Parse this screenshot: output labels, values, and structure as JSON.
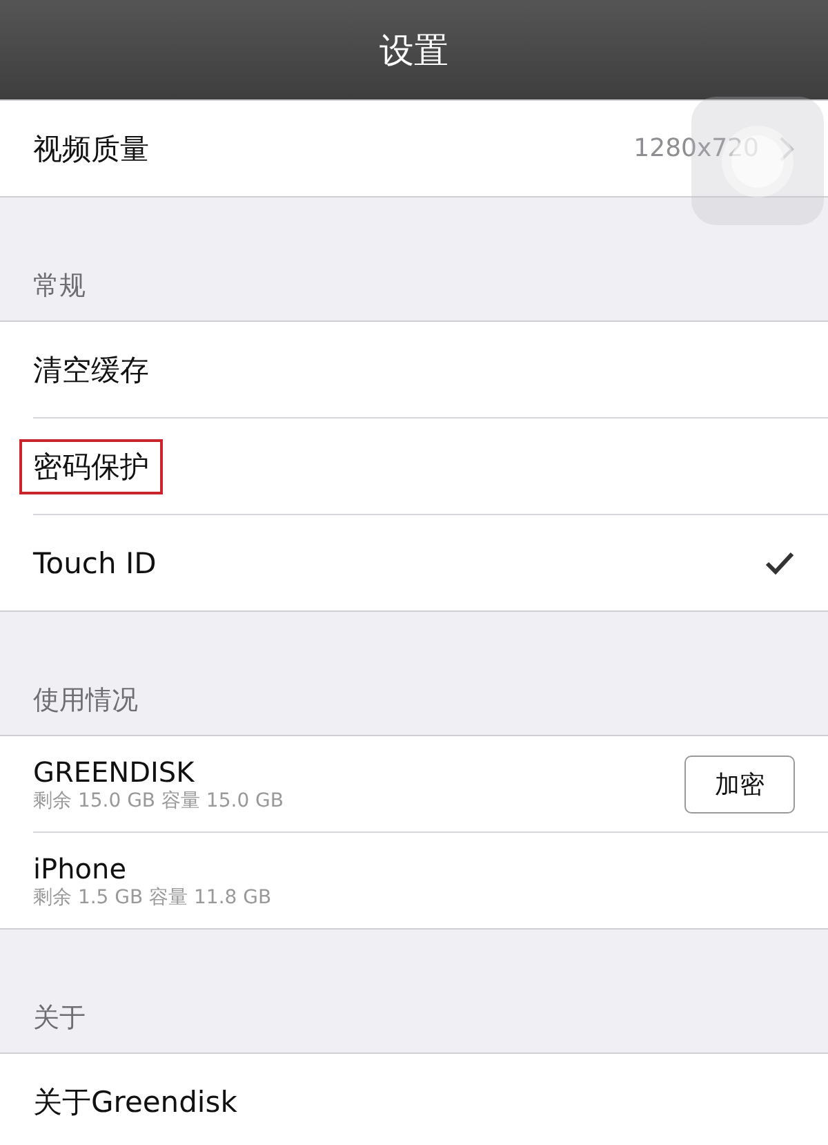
{
  "header": {
    "title": "设置"
  },
  "sections": [
    {
      "rows": [
        {
          "kind": "link",
          "label": "视频质量",
          "value": "1280x720"
        }
      ]
    },
    {
      "title": "常规",
      "rows": [
        {
          "kind": "plain",
          "label": "清空缓存",
          "highlighted": false
        },
        {
          "kind": "plain",
          "label": "密码保护",
          "highlighted": true
        },
        {
          "kind": "check",
          "label": "Touch ID",
          "checked": true
        }
      ]
    },
    {
      "title": "使用情况",
      "rows": [
        {
          "kind": "storage",
          "label": "GREENDISK",
          "detail": "剩余 15.0 GB 容量 15.0 GB",
          "button": "加密"
        },
        {
          "kind": "storage",
          "label": "iPhone",
          "detail": "剩余 1.5 GB 容量 11.8 GB"
        }
      ]
    },
    {
      "title": "关于",
      "rows": [
        {
          "kind": "plain",
          "label": "关于Greendisk",
          "highlighted": false
        }
      ]
    }
  ]
}
